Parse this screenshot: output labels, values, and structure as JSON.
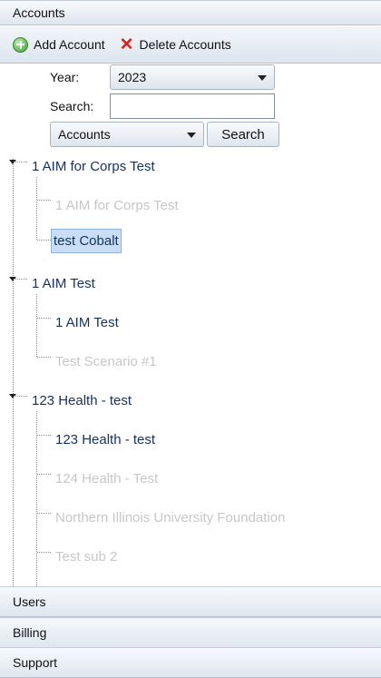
{
  "panels": {
    "accounts": "Accounts",
    "users": "Users",
    "billing": "Billing",
    "support": "Support"
  },
  "toolbar": {
    "add_account": "Add Account",
    "delete_accounts": "Delete Accounts",
    "add_icon": "plus-circle-icon",
    "delete_icon": "red-x-icon"
  },
  "form": {
    "year_label": "Year:",
    "year_value": "2023",
    "search_label": "Search:",
    "search_value": "",
    "filter_value": "Accounts",
    "search_button": "Search"
  },
  "tree": {
    "groups": [
      {
        "label": "1 AIM for Corps Test",
        "children": [
          {
            "label": "1 AIM for Corps Test",
            "state": "inactive"
          },
          {
            "label": "test Cobalt",
            "state": "selected"
          }
        ]
      },
      {
        "label": "1 AIM Test",
        "children": [
          {
            "label": "1 AIM Test",
            "state": "active"
          },
          {
            "label": "Test Scenario #1",
            "state": "inactive"
          }
        ]
      },
      {
        "label": "123 Health - test",
        "children": [
          {
            "label": "123 Health - test",
            "state": "active"
          },
          {
            "label": "124 Health - Test",
            "state": "inactive"
          },
          {
            "label": "Northern Illinois University Foundation",
            "state": "inactive"
          },
          {
            "label": "Test sub 2",
            "state": "inactive"
          }
        ]
      }
    ]
  },
  "colors": {
    "active_text": "#15325a",
    "inactive_text": "#c7c7c7",
    "selected_bg": "#c9def6",
    "delete_red": "#d8231a"
  }
}
